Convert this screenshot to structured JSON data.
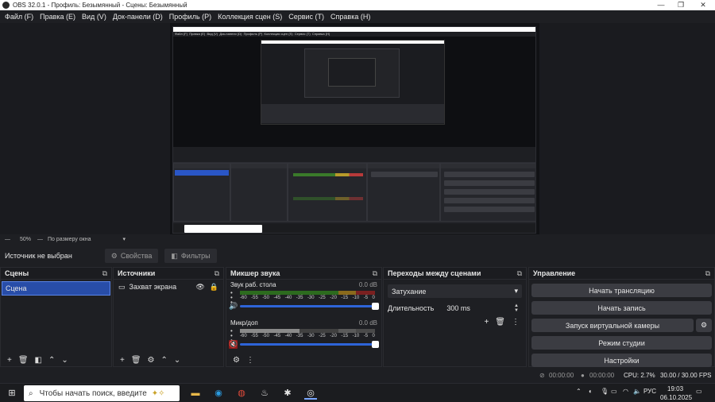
{
  "window": {
    "title": "OBS 32.0.1 - Профиль: Безымянный - Сцены: Безымянный",
    "minimize_icon": "minimize-icon",
    "maximize_icon": "maximize-icon",
    "close_icon": "close-icon"
  },
  "menu": [
    "Файл (F)",
    "Правка (E)",
    "Вид (V)",
    "Док-панели (D)",
    "Профиль (P)",
    "Коллекция сцен (S)",
    "Сервис (T)",
    "Справка (H)"
  ],
  "zoom": {
    "percent": "50%",
    "mode": "По размеру окна"
  },
  "source_bar": {
    "label": "Источник не выбран",
    "properties": "Свойства",
    "filters": "Фильтры"
  },
  "scenes": {
    "title": "Сцены",
    "items": [
      "Сцена"
    ]
  },
  "sources": {
    "title": "Источники",
    "items": [
      "Захват экрана"
    ]
  },
  "mixer": {
    "title": "Микшер звука",
    "scale": [
      "-60",
      "-55",
      "-50",
      "-45",
      "-40",
      "-35",
      "-30",
      "-25",
      "-20",
      "-15",
      "-10",
      "-5",
      "0"
    ],
    "channels": [
      {
        "name": "Звук раб. стола",
        "db": "0.0 dB",
        "muted": false
      },
      {
        "name": "Микр/доп",
        "db": "0.0 dB",
        "muted": true
      }
    ]
  },
  "transitions": {
    "title": "Переходы между сценами",
    "selected": "Затухание",
    "duration_label": "Длительность",
    "duration_value": "300 ms"
  },
  "controls": {
    "title": "Управление",
    "start_stream": "Начать трансляцию",
    "start_record": "Начать запись",
    "virtual_cam": "Запуск виртуальной камеры",
    "studio_mode": "Режим студии",
    "settings": "Настройки"
  },
  "status": {
    "stream_time": "00:00:00",
    "record_time": "00:00:00",
    "cpu": "CPU: 2.7%",
    "fps": "30.00 / 30.00 FPS"
  },
  "taskbar": {
    "search_placeholder": "Чтобы начать поиск, введите",
    "lang": "РУС",
    "time": "19:03",
    "date": "06.10.2025"
  }
}
